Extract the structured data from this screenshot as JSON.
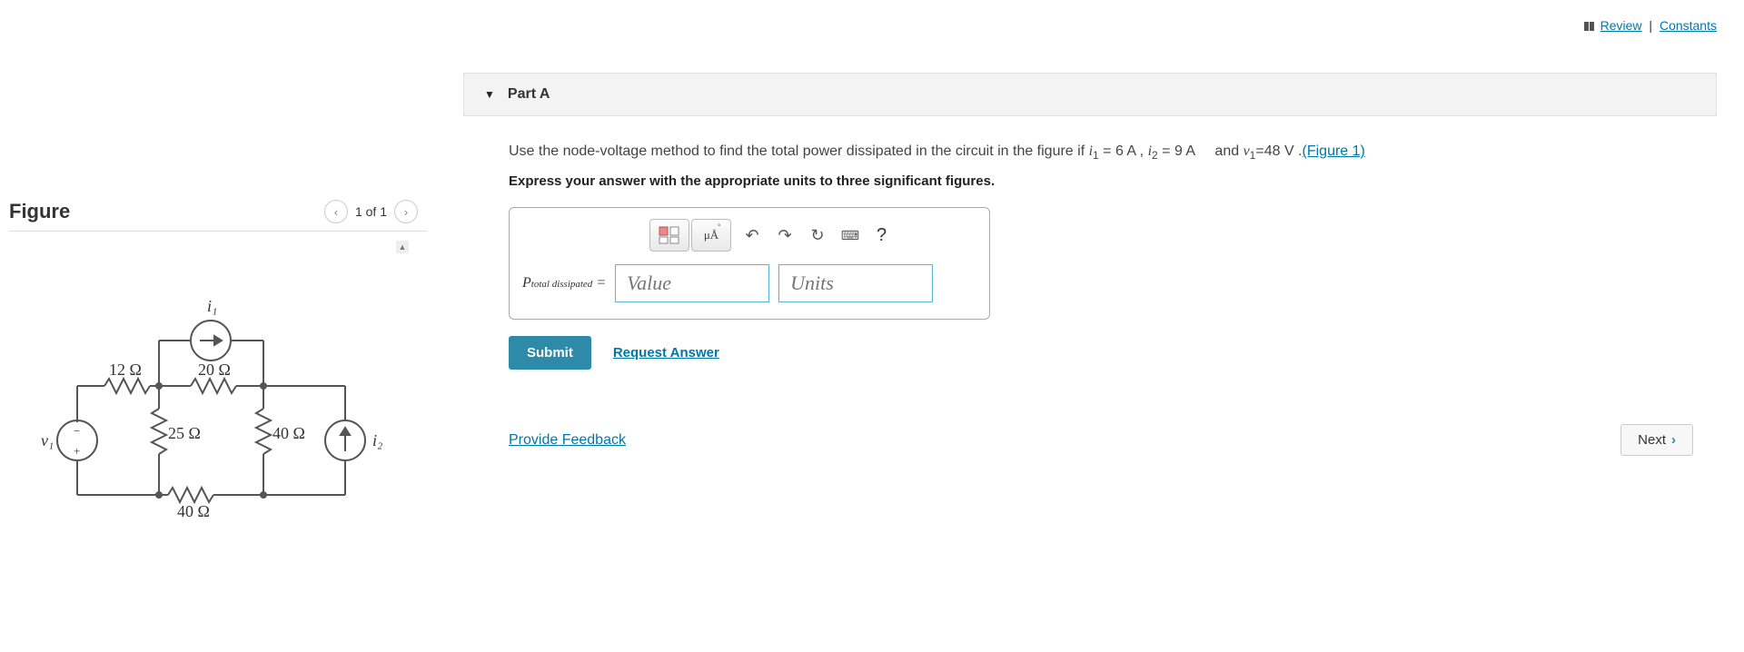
{
  "topLinks": {
    "review": "Review",
    "constants": "Constants"
  },
  "figure": {
    "title": "Figure",
    "navLabel": "1 of 1",
    "labels": {
      "i1": "i₁",
      "i2": "i₂",
      "v1": "v₁",
      "r12": "12 Ω",
      "r20": "20 Ω",
      "r25": "25 Ω",
      "r40a": "40 Ω",
      "r40b": "40 Ω"
    }
  },
  "part": {
    "title": "Part A",
    "question_pre": "Use the node-voltage method to find the total power dissipated in the circuit in the figure if ",
    "i1_sym": "i",
    "i1_sub": "1",
    "i1_val": " = 6 A ",
    "comma": ", ",
    "i2_sym": "i",
    "i2_sub": "2",
    "i2_val": " = 9 A ",
    "and": "    and ",
    "v1_sym": "v",
    "v1_sub": "1",
    "v1_val": "=48 V .",
    "figLink": "(Figure 1)",
    "instruction": "Express your answer with the appropriate units to three significant figures.",
    "answerLabel_pre": "P",
    "answerLabel_sub": "total dissipated",
    "answerLabel_eq": " =",
    "valuePlaceholder": "Value",
    "unitsPlaceholder": "Units",
    "submit": "Submit",
    "requestAnswer": "Request Answer",
    "toolbar": {
      "templates": "□",
      "units": "μÅ",
      "undo": "↶",
      "redo": "↷",
      "reset": "↻",
      "keyboard": "⌨",
      "help": "?"
    }
  },
  "footer": {
    "provideFeedback": "Provide Feedback",
    "next": "Next"
  }
}
